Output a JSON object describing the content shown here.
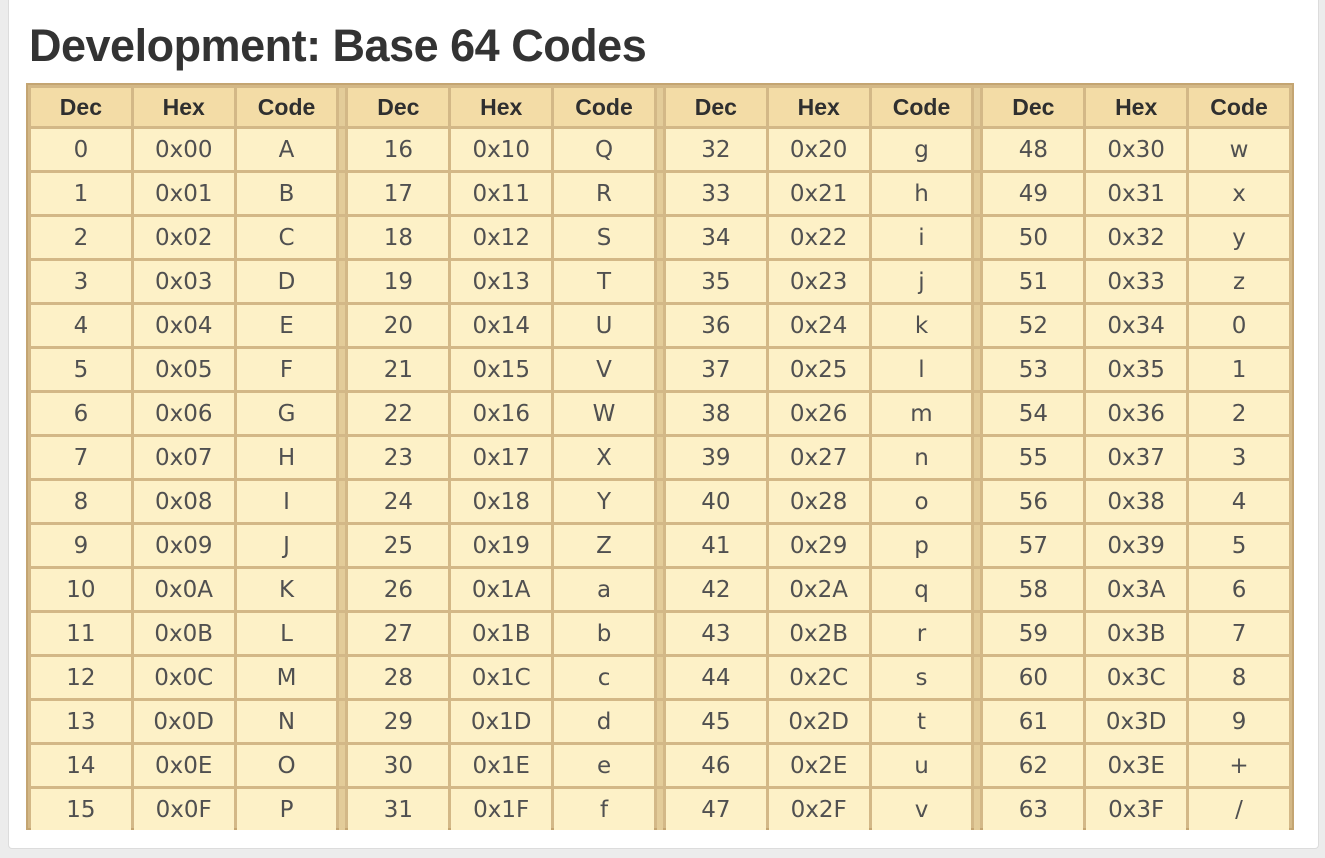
{
  "title": "Development: Base 64 Codes",
  "header": {
    "dec": "Dec",
    "hex": "Hex",
    "code": "Code"
  },
  "colors": {
    "header_bg": "#f3dca6",
    "cell_bg": "#fdf1c7",
    "border": "#d3b887",
    "title": "#333333"
  },
  "rows": [
    [
      [
        "0",
        "0x00",
        "A"
      ],
      [
        "16",
        "0x10",
        "Q"
      ],
      [
        "32",
        "0x20",
        "g"
      ],
      [
        "48",
        "0x30",
        "w"
      ]
    ],
    [
      [
        "1",
        "0x01",
        "B"
      ],
      [
        "17",
        "0x11",
        "R"
      ],
      [
        "33",
        "0x21",
        "h"
      ],
      [
        "49",
        "0x31",
        "x"
      ]
    ],
    [
      [
        "2",
        "0x02",
        "C"
      ],
      [
        "18",
        "0x12",
        "S"
      ],
      [
        "34",
        "0x22",
        "i"
      ],
      [
        "50",
        "0x32",
        "y"
      ]
    ],
    [
      [
        "3",
        "0x03",
        "D"
      ],
      [
        "19",
        "0x13",
        "T"
      ],
      [
        "35",
        "0x23",
        "j"
      ],
      [
        "51",
        "0x33",
        "z"
      ]
    ],
    [
      [
        "4",
        "0x04",
        "E"
      ],
      [
        "20",
        "0x14",
        "U"
      ],
      [
        "36",
        "0x24",
        "k"
      ],
      [
        "52",
        "0x34",
        "0"
      ]
    ],
    [
      [
        "5",
        "0x05",
        "F"
      ],
      [
        "21",
        "0x15",
        "V"
      ],
      [
        "37",
        "0x25",
        "l"
      ],
      [
        "53",
        "0x35",
        "1"
      ]
    ],
    [
      [
        "6",
        "0x06",
        "G"
      ],
      [
        "22",
        "0x16",
        "W"
      ],
      [
        "38",
        "0x26",
        "m"
      ],
      [
        "54",
        "0x36",
        "2"
      ]
    ],
    [
      [
        "7",
        "0x07",
        "H"
      ],
      [
        "23",
        "0x17",
        "X"
      ],
      [
        "39",
        "0x27",
        "n"
      ],
      [
        "55",
        "0x37",
        "3"
      ]
    ],
    [
      [
        "8",
        "0x08",
        "I"
      ],
      [
        "24",
        "0x18",
        "Y"
      ],
      [
        "40",
        "0x28",
        "o"
      ],
      [
        "56",
        "0x38",
        "4"
      ]
    ],
    [
      [
        "9",
        "0x09",
        "J"
      ],
      [
        "25",
        "0x19",
        "Z"
      ],
      [
        "41",
        "0x29",
        "p"
      ],
      [
        "57",
        "0x39",
        "5"
      ]
    ],
    [
      [
        "10",
        "0x0A",
        "K"
      ],
      [
        "26",
        "0x1A",
        "a"
      ],
      [
        "42",
        "0x2A",
        "q"
      ],
      [
        "58",
        "0x3A",
        "6"
      ]
    ],
    [
      [
        "11",
        "0x0B",
        "L"
      ],
      [
        "27",
        "0x1B",
        "b"
      ],
      [
        "43",
        "0x2B",
        "r"
      ],
      [
        "59",
        "0x3B",
        "7"
      ]
    ],
    [
      [
        "12",
        "0x0C",
        "M"
      ],
      [
        "28",
        "0x1C",
        "c"
      ],
      [
        "44",
        "0x2C",
        "s"
      ],
      [
        "60",
        "0x3C",
        "8"
      ]
    ],
    [
      [
        "13",
        "0x0D",
        "N"
      ],
      [
        "29",
        "0x1D",
        "d"
      ],
      [
        "45",
        "0x2D",
        "t"
      ],
      [
        "61",
        "0x3D",
        "9"
      ]
    ],
    [
      [
        "14",
        "0x0E",
        "O"
      ],
      [
        "30",
        "0x1E",
        "e"
      ],
      [
        "46",
        "0x2E",
        "u"
      ],
      [
        "62",
        "0x3E",
        "+"
      ]
    ],
    [
      [
        "15",
        "0x0F",
        "P"
      ],
      [
        "31",
        "0x1F",
        "f"
      ],
      [
        "47",
        "0x2F",
        "v"
      ],
      [
        "63",
        "0x3F",
        "/"
      ]
    ]
  ]
}
